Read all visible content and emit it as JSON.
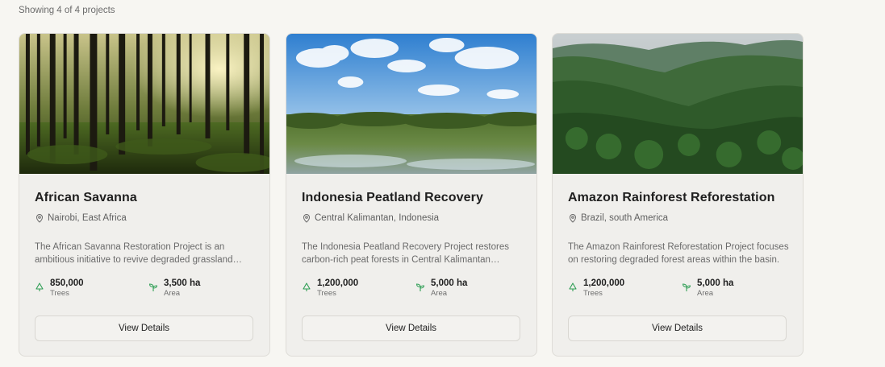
{
  "results": {
    "count_text": "Showing 4 of 4 projects"
  },
  "colors": {
    "accent_green": "#2f9e55",
    "card_bg": "#f0efec",
    "page_bg": "#f7f6f2"
  },
  "cards": [
    {
      "title": "African Savanna",
      "location": "Nairobi, East Africa",
      "description": "The African Savanna Restoration Project is an ambitious initiative to revive degraded grassland ecosystems and restore biodiversity across the region.",
      "trees_value": "850,000",
      "trees_label": "Trees",
      "area_value": "3,500 ha",
      "area_label": "Area",
      "button": "View Details",
      "image_icon": "forest-photo"
    },
    {
      "title": "Indonesia Peatland Recovery",
      "location": "Central Kalimantan, Indonesia",
      "description": "The Indonesia Peatland Recovery Project restores carbon-rich peat forests in Central Kalimantan through rewetting and replanting.",
      "trees_value": "1,200,000",
      "trees_label": "Trees",
      "area_value": "5,000 ha",
      "area_label": "Area",
      "button": "View Details",
      "image_icon": "peatland-photo"
    },
    {
      "title": "Amazon Rainforest Reforestation",
      "location": "Brazil, south America",
      "description": "The Amazon Rainforest Reforestation Project focuses on restoring degraded forest areas within the basin.",
      "trees_value": "1,200,000",
      "trees_label": "Trees",
      "area_value": "5,000 ha",
      "area_label": "Area",
      "button": "View Details",
      "image_icon": "rainforest-photo"
    }
  ]
}
